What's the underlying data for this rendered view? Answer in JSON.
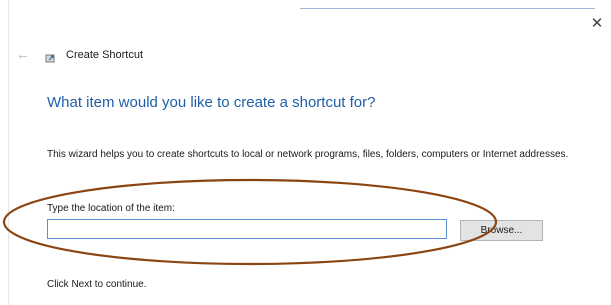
{
  "window": {
    "close_glyph": "✕",
    "back_glyph": "←",
    "title": "Create Shortcut"
  },
  "main": {
    "heading": "What item would you like to create a shortcut for?",
    "description": "This wizard helps you to create shortcuts to local or network programs, files, folders, computers or Internet addresses.",
    "field_label": "Type the location of the item:",
    "location_value": "",
    "browse_label": "Browse...",
    "footer": "Click Next to continue."
  },
  "colors": {
    "heading": "#1f5fa8",
    "input_border": "#5b8fd0",
    "annotation": "#8b4513"
  },
  "icons": {
    "back": "back-arrow-icon",
    "close": "close-icon",
    "wizard": "shortcut-wizard-icon"
  }
}
